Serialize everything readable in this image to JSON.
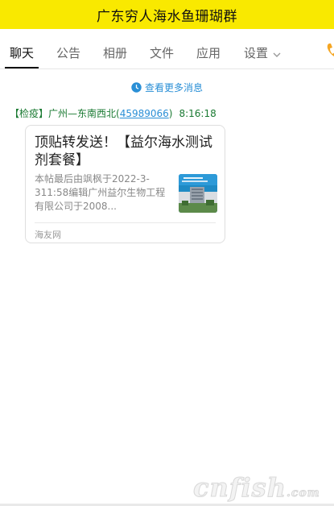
{
  "header": {
    "title": "广东穷人海水鱼珊瑚群"
  },
  "tabs": [
    {
      "label": "聊天",
      "active": true
    },
    {
      "label": "公告"
    },
    {
      "label": "相册"
    },
    {
      "label": "文件"
    },
    {
      "label": "应用"
    },
    {
      "label": "设置"
    }
  ],
  "history_link": {
    "label": "查看更多消息"
  },
  "message": {
    "sender_prefix": "【检疫】广州—东南西北(",
    "sender_id": "45989066",
    "sender_suffix": ")",
    "time": "8:16:18",
    "card": {
      "title": "顶贴转发送！【益尔海水测试剂套餐】",
      "description": "本帖最后由飒枫于2022-3-311:58编辑广州益尔生物工程有限公司于2008...",
      "source": "海友网"
    }
  },
  "watermark": {
    "main": "cnfish",
    "suffix": ".com"
  },
  "colors": {
    "header_bg": "#f9e900",
    "link": "#2a8fd6",
    "sender": "#1a7a32",
    "accent_icon": "#f5a623"
  }
}
